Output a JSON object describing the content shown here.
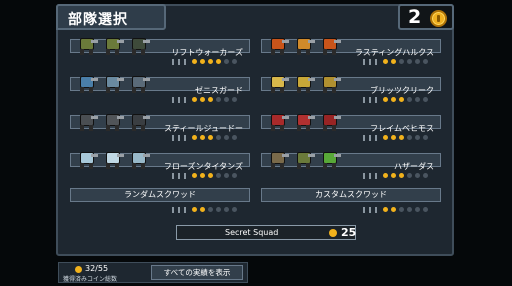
{
  "header": {
    "title": "部隊選択",
    "score": "2"
  },
  "squads": [
    {
      "name": "リフトウォーカーズ",
      "filled": 4,
      "mechs": [
        "#6b7a3a",
        "#6b7a3a",
        "#3e4a3a"
      ]
    },
    {
      "name": "ラスティングハルクス",
      "filled": 2,
      "mechs": [
        "#c8541a",
        "#d08a2a",
        "#c8541a"
      ]
    },
    {
      "name": "ゼニスガード",
      "filled": 3,
      "mechs": [
        "#4a7ea8",
        "#6a8aa0",
        "#5a6a78"
      ]
    },
    {
      "name": "ブリッツクリーク",
      "filled": 3,
      "mechs": [
        "#d8b84a",
        "#c8a838",
        "#b09030"
      ]
    },
    {
      "name": "スティールジュードー",
      "filled": 3,
      "mechs": [
        "#4a4e52",
        "#505458",
        "#3a3e42"
      ]
    },
    {
      "name": "フレイムベヒモス",
      "filled": 3,
      "mechs": [
        "#a82a2a",
        "#b03030",
        "#982424"
      ]
    },
    {
      "name": "フローズンタイタンズ",
      "filled": 3,
      "mechs": [
        "#a8c8d8",
        "#c0d8e4",
        "#98b8c8"
      ]
    },
    {
      "name": "ハザーダス",
      "filled": 3,
      "mechs": [
        "#7a6a4a",
        "#6a7a3a",
        "#58a838"
      ]
    }
  ],
  "random_squad": {
    "label": "ランダムスクワッド",
    "filled": 2
  },
  "custom_squad": {
    "label": "カスタムスクワッド",
    "filled": 2
  },
  "secret_squad": {
    "label": "Secret Squad",
    "cost": "25"
  },
  "footer": {
    "coins": "32/55",
    "coins_label": "獲得済みコイン総数",
    "achievements_button": "すべての実績を表示"
  }
}
